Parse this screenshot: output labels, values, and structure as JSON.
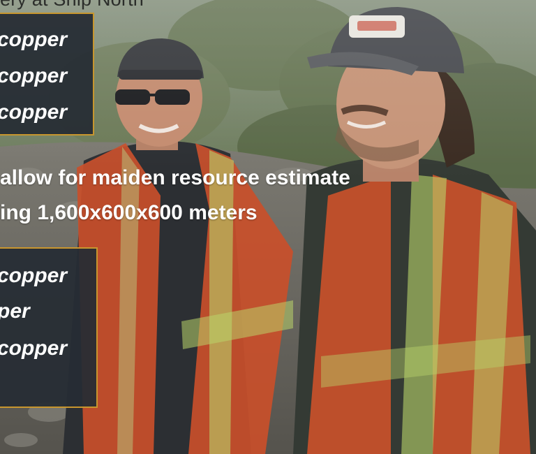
{
  "slide": {
    "heading": "ery at Ship North",
    "box_top": {
      "lines": [
        "copper",
        "copper",
        "copper"
      ]
    },
    "statement_lines": [
      "allow for maiden resource estimate",
      "ing 1,600x600x600 meters"
    ],
    "box_bottom": {
      "lines": [
        "copper",
        "per",
        "copper"
      ]
    },
    "colors": {
      "box_fill": "#262d34",
      "box_border": "#c8962e",
      "vest_orange": "#d2552a",
      "reflective_stripe": "#b9d36a"
    }
  },
  "photo": {
    "description_icons": [
      "person-left-icon",
      "person-right-icon"
    ]
  }
}
